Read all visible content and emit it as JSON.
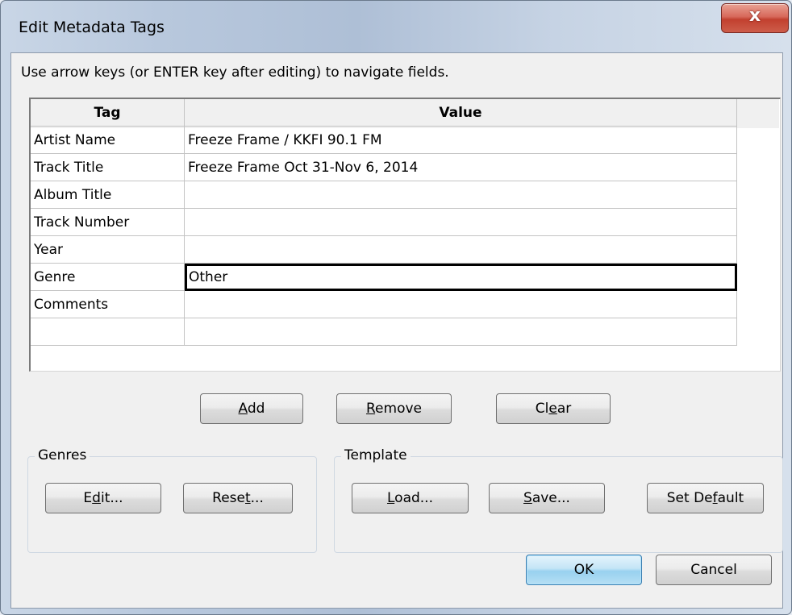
{
  "window": {
    "title": "Edit Metadata Tags",
    "close_glyph": "x"
  },
  "hint": "Use arrow keys (or ENTER key after editing) to navigate fields.",
  "table": {
    "headers": [
      "Tag",
      "Value"
    ],
    "rows": [
      {
        "tag": "Artist Name",
        "value": "Freeze Frame / KKFI 90.1 FM"
      },
      {
        "tag": "Track Title",
        "value": "Freeze Frame Oct 31-Nov 6, 2014"
      },
      {
        "tag": "Album Title",
        "value": ""
      },
      {
        "tag": "Track Number",
        "value": ""
      },
      {
        "tag": "Year",
        "value": ""
      },
      {
        "tag": "Genre",
        "value": "Other"
      },
      {
        "tag": "Comments",
        "value": ""
      },
      {
        "tag": "",
        "value": ""
      }
    ]
  },
  "buttons": {
    "add": {
      "pre": "",
      "key": "A",
      "post": "dd"
    },
    "remove": {
      "pre": "",
      "key": "R",
      "post": "emove"
    },
    "clear": {
      "pre": "Cl",
      "key": "e",
      "post": "ar"
    },
    "genres_edit": {
      "pre": "E",
      "key": "d",
      "post": "it..."
    },
    "genres_reset": {
      "pre": "Rese",
      "key": "t",
      "post": "..."
    },
    "template_load": {
      "pre": "",
      "key": "L",
      "post": "oad..."
    },
    "template_save": {
      "pre": "",
      "key": "S",
      "post": "ave..."
    },
    "template_default": {
      "pre": "Set De",
      "key": "f",
      "post": "ault"
    },
    "ok": "OK",
    "cancel": "Cancel"
  },
  "groups": {
    "genres": "Genres",
    "template": "Template"
  }
}
